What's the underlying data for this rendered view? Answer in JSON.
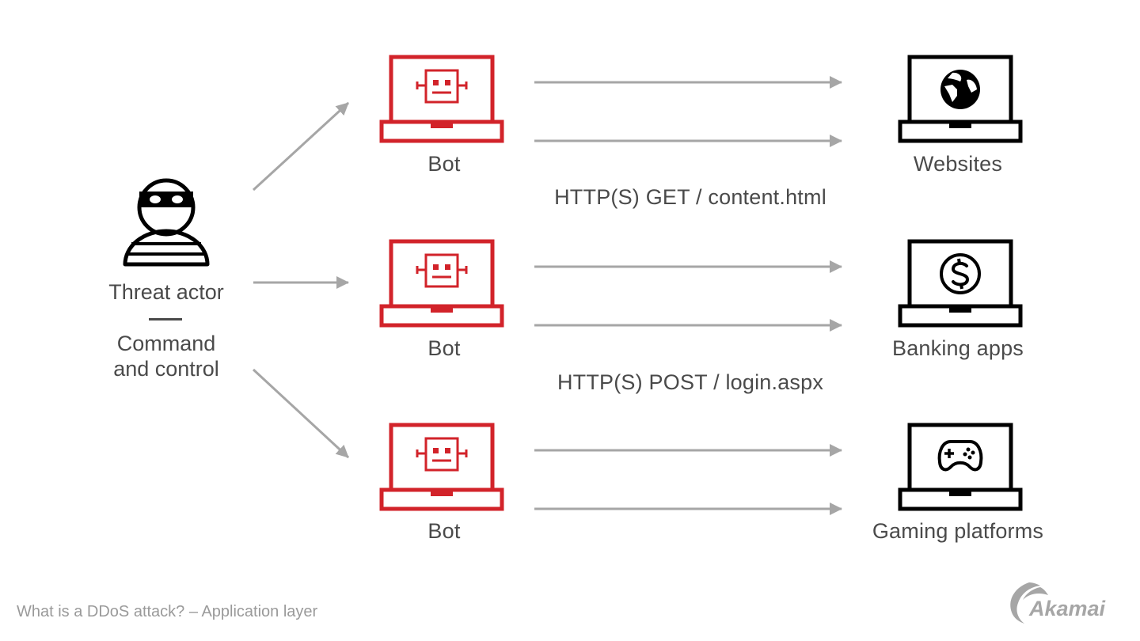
{
  "diagram": {
    "caption": "What is a DDoS attack? – Application layer",
    "logo_text": "Akamai",
    "colors": {
      "bot": "#d2232a",
      "target": "#000000",
      "arrow": "#a6a6a6",
      "text": "#4a4a4a",
      "caption": "#9a9a9a",
      "logo": "#a6a6a6"
    },
    "threat_actor": {
      "icon": "burglar-icon",
      "title": "Threat actor",
      "separator": "—",
      "subtitle_line1": "Command",
      "subtitle_line2": "and control"
    },
    "bots": [
      {
        "label": "Bot",
        "icon": "robot-laptop-icon"
      },
      {
        "label": "Bot",
        "icon": "robot-laptop-icon"
      },
      {
        "label": "Bot",
        "icon": "robot-laptop-icon"
      }
    ],
    "targets": [
      {
        "label": "Websites",
        "icon": "globe-icon"
      },
      {
        "label": "Banking apps",
        "icon": "dollar-coin-icon"
      },
      {
        "label": "Gaming platforms",
        "icon": "gamepad-icon"
      }
    ],
    "requests": [
      {
        "label": "HTTP(S) GET / content.html"
      },
      {
        "label": "HTTP(S) POST / login.aspx"
      }
    ],
    "edges": [
      {
        "from": "threat_actor",
        "to": "bots.0"
      },
      {
        "from": "threat_actor",
        "to": "bots.1"
      },
      {
        "from": "threat_actor",
        "to": "bots.2"
      },
      {
        "from": "bots.0",
        "to": "targets.0",
        "count": 2
      },
      {
        "from": "bots.1",
        "to": "targets.1",
        "count": 2
      },
      {
        "from": "bots.2",
        "to": "targets.2",
        "count": 2
      }
    ]
  }
}
